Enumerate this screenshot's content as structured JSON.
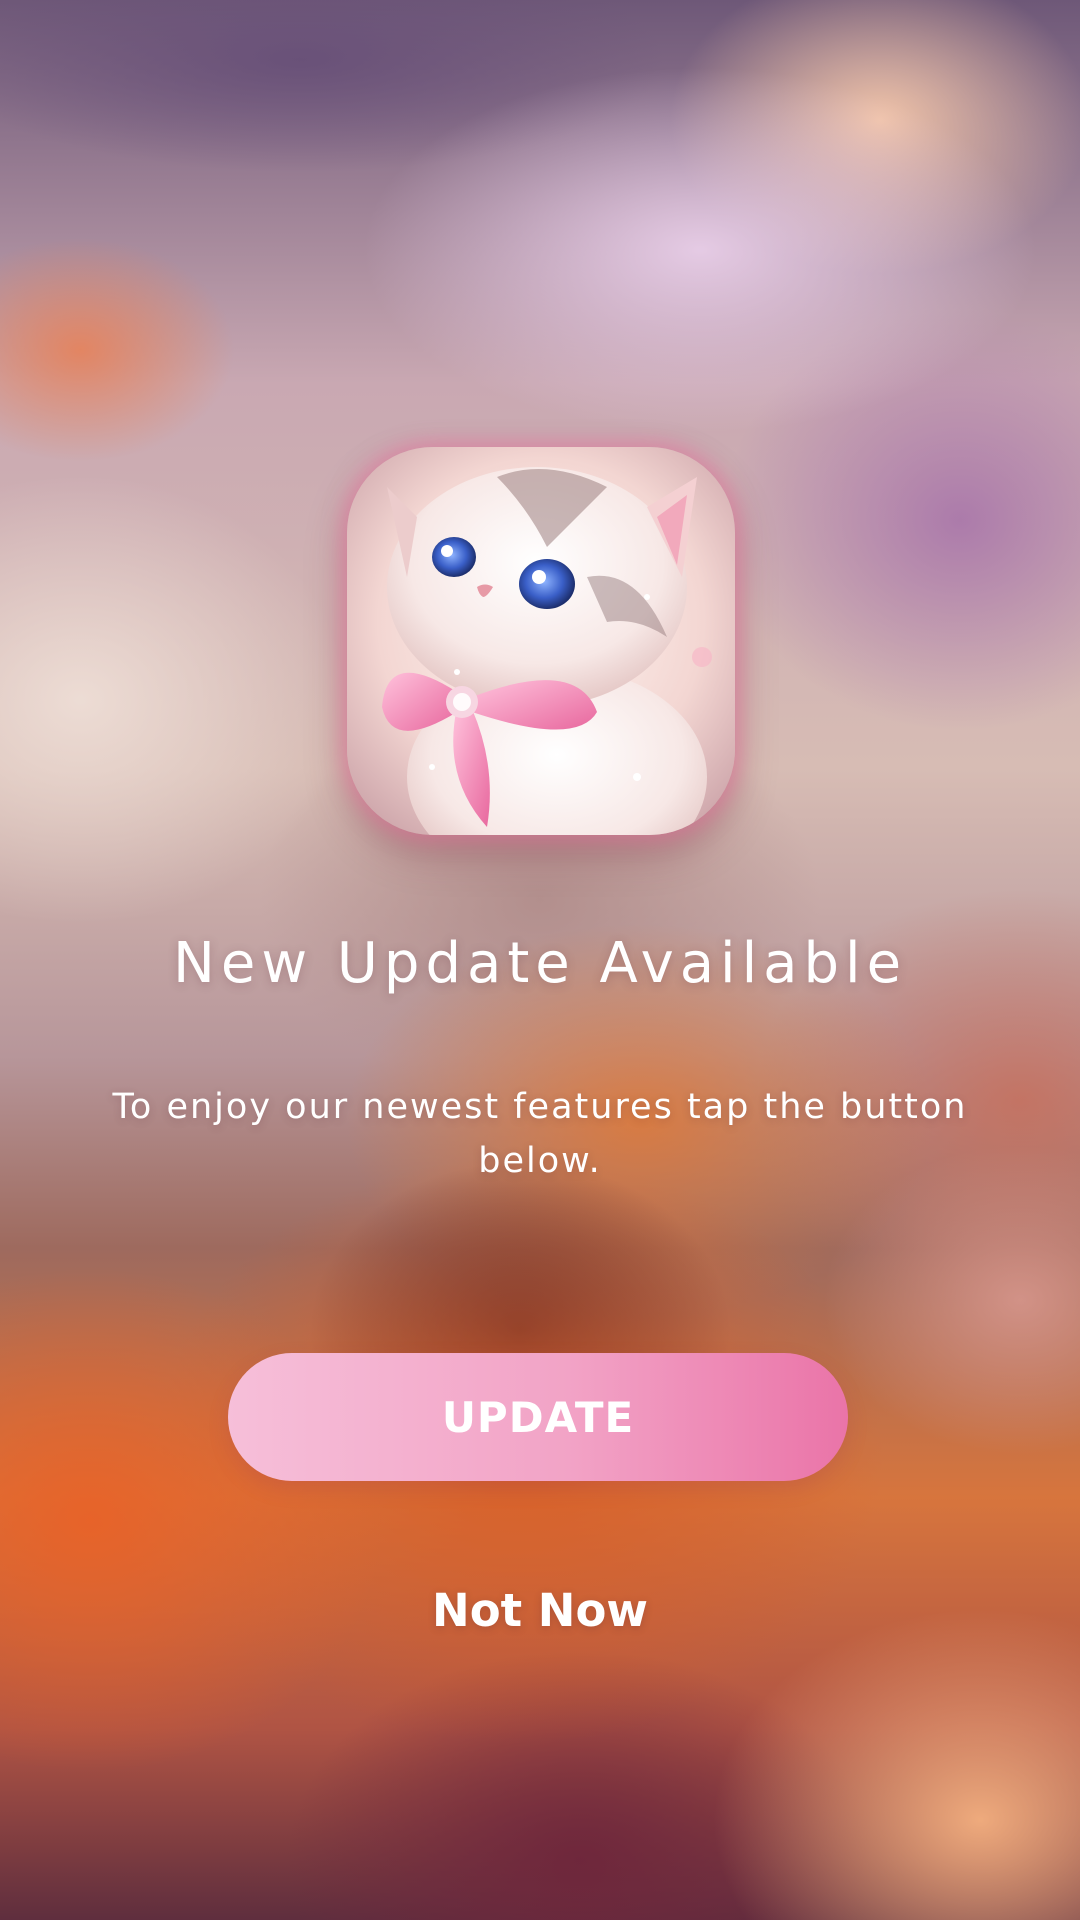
{
  "dialog": {
    "app_icon": "kitten-with-pink-bow-app-icon",
    "title": "New Update Available",
    "message": "To enjoy our newest features tap the button below.",
    "update_label": "UPDATE",
    "dismiss_label": "Not Now"
  },
  "colors": {
    "button_gradient_start": "#f6bfd9",
    "button_gradient_end": "#ea74a8",
    "text": "#ffffff"
  }
}
